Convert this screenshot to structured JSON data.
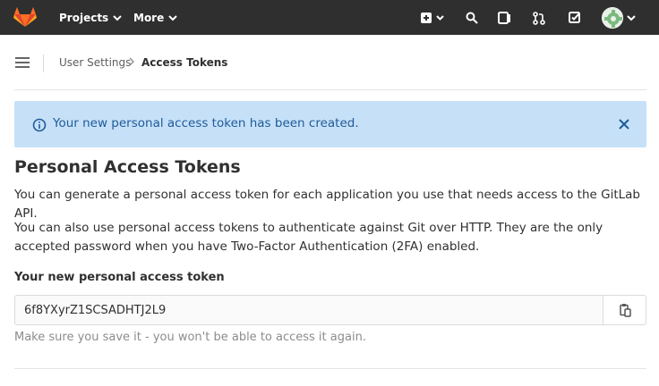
{
  "navbar": {
    "projects_label": "Projects",
    "more_label": "More",
    "icons": [
      "plus-square-icon",
      "search-icon",
      "issues-icon",
      "merge-request-icon",
      "todo-check-icon"
    ]
  },
  "breadcrumb": {
    "parent": "User Settings",
    "current": "Access Tokens"
  },
  "alert": {
    "message": "Your new personal access token has been created.",
    "color": "#c6e1f7"
  },
  "page": {
    "title": "Personal Access Tokens",
    "paragraph1": "You can generate a personal access token for each application you use that needs access to the GitLab API.",
    "paragraph2": "You can also use personal access tokens to authenticate against Git over HTTP. They are the only accepted password when you have Two-Factor Authentication (2FA) enabled."
  },
  "token": {
    "label": "Your new personal access token",
    "value": "6f8YXyrZ1SCSADHTJ2L9",
    "help": "Make sure you save it - you won't be able to access it again."
  }
}
